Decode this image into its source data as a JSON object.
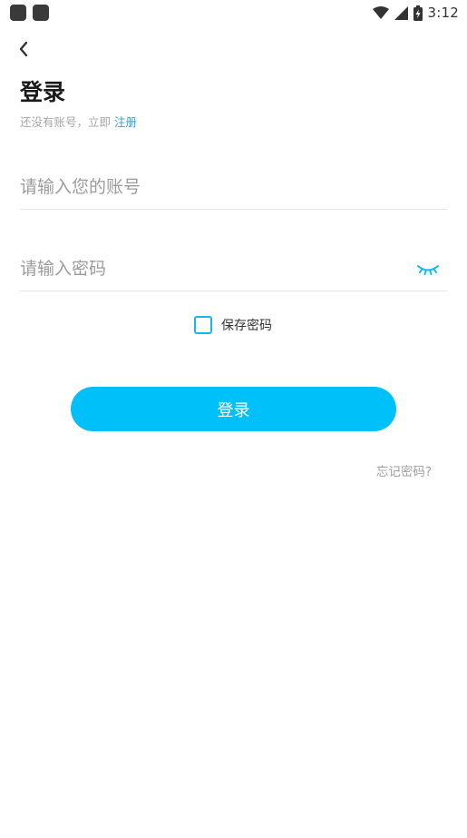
{
  "status_bar": {
    "time": "3:12",
    "icons": [
      "notification-icon",
      "notification-icon",
      "wifi-icon",
      "signal-icon",
      "battery-icon"
    ]
  },
  "header": {
    "back_icon": "chevron-left-icon",
    "title": "登录",
    "subtitle_prefix": "还没有账号，立即 ",
    "register_link": "注册"
  },
  "form": {
    "account_placeholder": "请输入您的账号",
    "password_placeholder": "请输入密码",
    "password_toggle_icon": "eye-closed-icon",
    "save_password_label": "保存密码",
    "save_password_checked": false,
    "login_button": "登录",
    "forgot_password": "忘记密码?"
  },
  "colors": {
    "accent": "#00c0fa",
    "link": "#1fa8e6",
    "placeholder": "#9b9b9b",
    "divider": "#e6e6e6"
  }
}
